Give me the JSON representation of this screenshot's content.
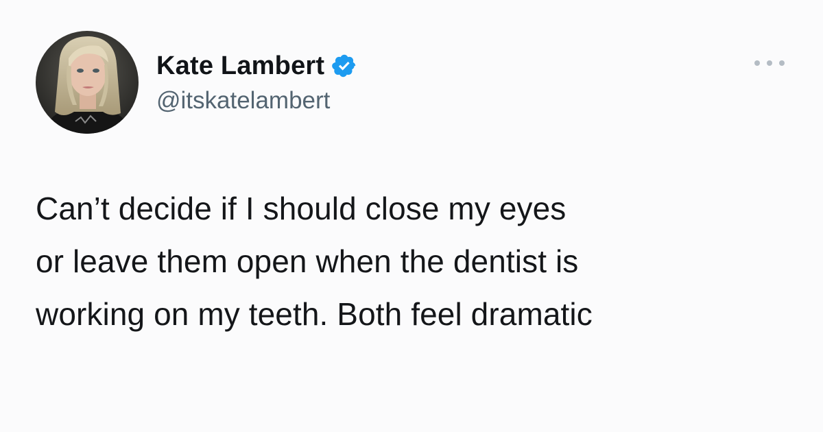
{
  "tweet": {
    "author": {
      "display_name": "Kate Lambert",
      "handle": "@itskatelambert",
      "verified": true,
      "avatar_icon": "profile-photo"
    },
    "text_lines": [
      "Can’t decide if I should close my eyes",
      "or leave them open when the dentist is",
      "working on my teeth. Both feel dramatic"
    ],
    "menu_icon": "more-horizontal-icon"
  },
  "colors": {
    "background": "#fbfbfc",
    "text": "#141619",
    "handle": "#536471",
    "verified_badge": "#1d9bf0"
  }
}
